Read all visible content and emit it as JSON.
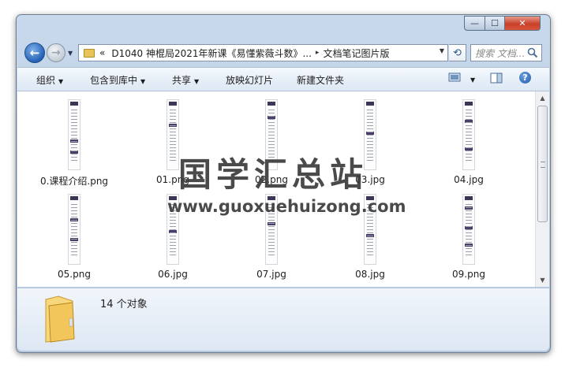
{
  "window": {
    "minimize_glyph": "—",
    "maximize_glyph": "☐",
    "close_glyph": "✕"
  },
  "nav": {
    "back_glyph": "←",
    "forward_glyph": "→",
    "dropdown_glyph": "▼"
  },
  "address": {
    "overflow": "«",
    "crumbs": [
      "D1040 神棍局2021年新课《易懂紫薇斗数》...",
      "文档笔记图片版"
    ],
    "separator": "▸",
    "dropdown_glyph": "▼",
    "refresh_glyph": "⟲"
  },
  "search": {
    "placeholder": "搜索 文档..."
  },
  "toolbar": {
    "organize": "组织",
    "include_in_library": "包含到库中",
    "share": "共享",
    "slideshow": "放映幻灯片",
    "new_folder": "新建文件夹",
    "arrow": "▼",
    "help_glyph": "?"
  },
  "files": [
    {
      "name": "0.课程介绍.png"
    },
    {
      "name": "01.png"
    },
    {
      "name": "02.png"
    },
    {
      "name": "03.jpg"
    },
    {
      "name": "04.jpg"
    },
    {
      "name": "05.png"
    },
    {
      "name": "06.jpg"
    },
    {
      "name": "07.jpg"
    },
    {
      "name": "08.jpg"
    },
    {
      "name": "09.png"
    }
  ],
  "watermark": {
    "title": "国学汇总站",
    "url": "www.guoxuehuizong.com"
  },
  "details": {
    "object_count": "14 个对象"
  },
  "scrollbar": {
    "up_glyph": "▲",
    "down_glyph": "▼"
  },
  "colors": {
    "window_frame": "#b9cde6",
    "toolbar": "#e7eff8",
    "details": "#dde7f3",
    "close_button": "#c8412a"
  }
}
